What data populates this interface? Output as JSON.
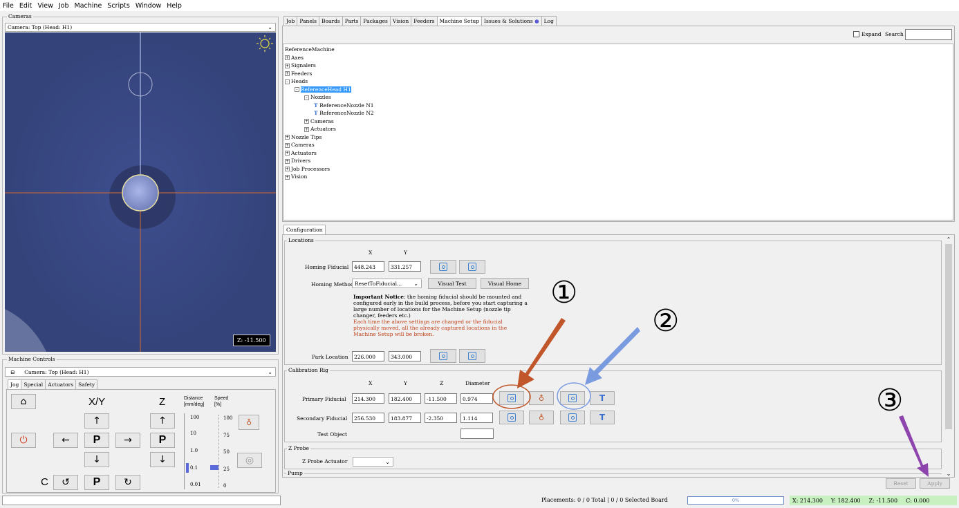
{
  "menu": [
    "File",
    "Edit",
    "View",
    "Job",
    "Machine",
    "Scripts",
    "Window",
    "Help"
  ],
  "cameras": {
    "title": "Cameras",
    "selected": "Camera: Top (Head: H1)",
    "z_readout": "Z: -11.500"
  },
  "machine_controls": {
    "title": "Machine Controls",
    "camera": "Camera: Top (Head: H1)",
    "tabs": [
      "Jog",
      "Special",
      "Actuators",
      "Safety"
    ],
    "xy": "X/Y",
    "z": "Z",
    "c": "C",
    "p": "P",
    "distance_label": "Distance\n[mm/deg]",
    "speed_label": "Speed\n[%]",
    "distances": [
      "100",
      "10",
      "1.0",
      "0.1",
      "0.01"
    ],
    "speeds": [
      "100",
      "75",
      "50",
      "25",
      "0"
    ]
  },
  "main_tabs": [
    "Job",
    "Panels",
    "Boards",
    "Parts",
    "Packages",
    "Vision",
    "Feeders",
    "Machine Setup",
    "Issues & Solutions",
    "Log"
  ],
  "expand_search": "Expand",
  "search_label": "Search",
  "tree": [
    {
      "d": 0,
      "t": "ReferenceMachine",
      "pm": ""
    },
    {
      "d": 0,
      "t": "Axes",
      "pm": "+"
    },
    {
      "d": 0,
      "t": "Signalers",
      "pm": "+"
    },
    {
      "d": 0,
      "t": "Feeders",
      "pm": "+"
    },
    {
      "d": 0,
      "t": "Heads",
      "pm": "-"
    },
    {
      "d": 1,
      "t": "ReferenceHead H1",
      "pm": "-",
      "sel": true
    },
    {
      "d": 2,
      "t": "Nozzles",
      "pm": "-"
    },
    {
      "d": 3,
      "t": "ReferenceNozzle N1",
      "pm": "n"
    },
    {
      "d": 3,
      "t": "ReferenceNozzle N2",
      "pm": "n"
    },
    {
      "d": 2,
      "t": "Cameras",
      "pm": "+"
    },
    {
      "d": 2,
      "t": "Actuators",
      "pm": "+"
    },
    {
      "d": 0,
      "t": "Nozzle Tips",
      "pm": "+"
    },
    {
      "d": 0,
      "t": "Cameras",
      "pm": "+"
    },
    {
      "d": 0,
      "t": "Actuators",
      "pm": "+"
    },
    {
      "d": 0,
      "t": "Drivers",
      "pm": "+"
    },
    {
      "d": 0,
      "t": "Job Processors",
      "pm": "+"
    },
    {
      "d": 0,
      "t": "Vision",
      "pm": "+"
    }
  ],
  "config": {
    "tab": "Configuration",
    "locations": {
      "title": "Locations",
      "x": "X",
      "y": "Y",
      "homing_fiducial": "Homing Fiducial",
      "hf_x": "448.243",
      "hf_y": "331.257",
      "homing_method": "Homing Method",
      "method_value": "ResetToFiducial...",
      "visual_test": "Visual Test",
      "visual_home": "Visual Home",
      "notice_bold": "Important Notice",
      "notice": ": the homing fiducial should be mounted and configured early in the build process, before you start capturing a large number of locations for the Machine Setup (nozzle tip changer, feeders etc.)",
      "notice_red": "Each time the above settings are changed or the fiducial physically moved, all the already captured locations in the Machine Setup will be broken.",
      "park": "Park Location",
      "park_x": "226.000",
      "park_y": "343.000"
    },
    "calibration": {
      "title": "Calibration Rig",
      "x": "X",
      "y": "Y",
      "z": "Z",
      "diameter": "Diameter",
      "primary": "Primary Fiducial",
      "p_x": "214.300",
      "p_y": "182.400",
      "p_z": "-11.500",
      "p_d": "0.974",
      "secondary": "Secondary Fiducial",
      "s_x": "256.530",
      "s_y": "183.877",
      "s_z": "-2.350",
      "s_d": "1.114",
      "test_object": "Test Object"
    },
    "zprobe": {
      "title": "Z Probe",
      "actuator": "Z Probe Actuator"
    },
    "pump": "Pump",
    "reset": "Reset",
    "apply": "Apply"
  },
  "annotations": {
    "one": "①",
    "two": "②",
    "three": "③"
  },
  "status": {
    "placements": "Placements: 0 / 0 Total | 0 / 0 Selected Board",
    "progress": "0%",
    "progress_value": 0,
    "x": "X: 214.300",
    "y": "Y: 182.400",
    "z": "Z: -11.500",
    "c": "C: 0.000"
  },
  "colors": {
    "cam_bg": "#3a4a86",
    "crosshair": "#d86a30",
    "tree_sel": "#3399ff",
    "annot1": "#c0562a",
    "annot2": "#7b9be0",
    "annot3": "#8e44ad",
    "status_green": "#c8f0c0"
  }
}
